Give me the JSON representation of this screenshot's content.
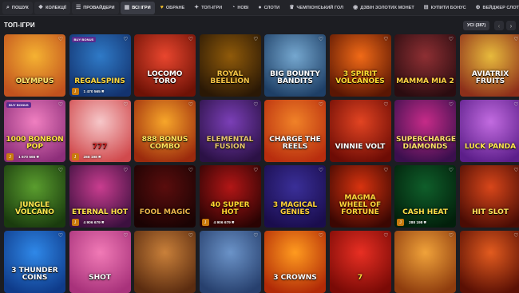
{
  "nav": [
    {
      "label": "ПОШУК",
      "icon": "search-icon",
      "glyph": "⌕",
      "style": "normal"
    },
    {
      "label": "КОЛЕКЦІЇ",
      "icon": "collections-icon",
      "glyph": "❖",
      "style": "normal"
    },
    {
      "label": "ПРОВАЙДЕРИ",
      "icon": "providers-icon",
      "glyph": "☰",
      "style": "normal"
    },
    {
      "label": "ВСІ ІГРИ",
      "icon": "grid-icon",
      "glyph": "▦",
      "style": "active"
    },
    {
      "label": "ОБРАНЕ",
      "icon": "heart-icon",
      "glyph": "♥",
      "style": "plain"
    },
    {
      "label": "ТОП-ІГРИ",
      "icon": "fire-icon",
      "glyph": "✦",
      "style": "plain"
    },
    {
      "label": "НОВІ",
      "icon": "new-icon",
      "glyph": "◔",
      "style": "plain"
    },
    {
      "label": "СЛОТИ",
      "icon": "slots-icon",
      "glyph": "●",
      "style": "plain"
    },
    {
      "label": "ЧЕМПІОНСЬКИЙ ГОЛ",
      "icon": "trophy-icon",
      "glyph": "♛",
      "style": "plain"
    },
    {
      "label": "ДЗВІН ЗОЛОТИХ МОНЕТ",
      "icon": "coin-icon",
      "glyph": "◉",
      "style": "plain"
    },
    {
      "label": "КУПИТИ БОНУС",
      "icon": "bonus-icon",
      "glyph": "⊞",
      "style": "plain"
    },
    {
      "label": "ВЕЙДЖЕР СЛОТИ",
      "icon": "wager-icon",
      "glyph": "⊕",
      "style": "plain"
    }
  ],
  "section": {
    "title": "ТОП-ІГРИ",
    "all_label": "УСІ (387)",
    "prev": "‹",
    "next": "›"
  },
  "heart_glyph": "♡",
  "jp_glyph": "J",
  "tiles": [
    {
      "title": "OLYMPUS",
      "badge": "",
      "jackpot": "",
      "bg": [
        "#f5b232",
        "#c1521e"
      ],
      "title_color": "#ffe66d"
    },
    {
      "title": "REGALSPINS",
      "badge": "BUY BONUS",
      "jackpot": "1 470 565 ₴",
      "bg": [
        "#2f7ac7",
        "#13336f"
      ],
      "title_color": "#ffd83d"
    },
    {
      "title": "LOCOMO TORO",
      "badge": "",
      "jackpot": "",
      "bg": [
        "#e9462e",
        "#6e1206"
      ],
      "title_color": "#ffffff"
    },
    {
      "title": "ROYAL BEELLION",
      "badge": "",
      "jackpot": "",
      "bg": [
        "#8f5a0a",
        "#2a1805"
      ],
      "title_color": "#f6c545"
    },
    {
      "title": "BIG BOUNTY BANDITS",
      "badge": "",
      "jackpot": "",
      "bg": [
        "#75a7cf",
        "#1e3f66"
      ],
      "title_color": "#ffffff"
    },
    {
      "title": "3 SPIRIT VOLCANOES",
      "badge": "",
      "jackpot": "",
      "bg": [
        "#f16a17",
        "#5a1603"
      ],
      "title_color": "#ffdd33"
    },
    {
      "title": "MAMMA MIA 2",
      "badge": "",
      "jackpot": "",
      "bg": [
        "#8e2f33",
        "#2a0c10"
      ],
      "title_color": "#ffd544"
    },
    {
      "title": "AVIATRIX FRUITS",
      "badge": "",
      "jackpot": "",
      "bg": [
        "#e7ba3c",
        "#8d2f1a"
      ],
      "title_color": "#ffffff"
    },
    {
      "title": "1000 BONBON POP",
      "badge": "BUY BONUS",
      "jackpot": "1 670 565 ₴",
      "bg": [
        "#f07fc0",
        "#8d2e7a"
      ],
      "title_color": "#ffe33e"
    },
    {
      "title": "777",
      "badge": "",
      "jackpot": "288 198 ₴",
      "bg": [
        "#f6c7c9",
        "#d14a4d"
      ],
      "title_color": "#d21d1d"
    },
    {
      "title": "888 BONUS COMBO",
      "badge": "",
      "jackpot": "",
      "bg": [
        "#f7a62a",
        "#9b2a0d"
      ],
      "title_color": "#ffe35b"
    },
    {
      "title": "ELEMENTAL FUSION",
      "badge": "",
      "jackpot": "",
      "bg": [
        "#7b3fb7",
        "#2b1145"
      ],
      "title_color": "#e7c66a"
    },
    {
      "title": "CHARGE THE REELS",
      "badge": "",
      "jackpot": "",
      "bg": [
        "#f08228",
        "#b82d0e"
      ],
      "title_color": "#ffffff"
    },
    {
      "title": "VINNIE VOLT",
      "badge": "",
      "jackpot": "",
      "bg": [
        "#e24422",
        "#6d0c05"
      ],
      "title_color": "#ffffff"
    },
    {
      "title": "SUPERCHARGED DIAMONDS",
      "badge": "",
      "jackpot": "",
      "bg": [
        "#c62b88",
        "#3b0f4e"
      ],
      "title_color": "#ffe06a"
    },
    {
      "title": "LUCK PANDA",
      "badge": "",
      "jackpot": "",
      "bg": [
        "#c26be0",
        "#5c1e8a"
      ],
      "title_color": "#ffe650"
    },
    {
      "title": "JUNGLE VOLCANO",
      "badge": "",
      "jackpot": "",
      "bg": [
        "#5a9d2e",
        "#1a3b0e"
      ],
      "title_color": "#ffe64d"
    },
    {
      "title": "ETERNAL HOT",
      "badge": "",
      "jackpot": "4 906 679 ₴",
      "bg": [
        "#c93d8f",
        "#3c103f"
      ],
      "title_color": "#ffe24a"
    },
    {
      "title": "FOOL MAGIC",
      "badge": "",
      "jackpot": "",
      "bg": [
        "#5a0d0d",
        "#1a0303"
      ],
      "title_color": "#e8b54a"
    },
    {
      "title": "40 SUPER HOT",
      "badge": "",
      "jackpot": "4 906 679 ₴",
      "bg": [
        "#b21616",
        "#2a0303"
      ],
      "title_color": "#ffd630"
    },
    {
      "title": "3 MAGICAL GENIES",
      "badge": "",
      "jackpot": "",
      "bg": [
        "#3a2f98",
        "#1a0d4d"
      ],
      "title_color": "#ffd23a"
    },
    {
      "title": "MAGMA WHEEL OF FORTUNE",
      "badge": "",
      "jackpot": "",
      "bg": [
        "#d8330f",
        "#3b0702"
      ],
      "title_color": "#ffd53a"
    },
    {
      "title": "CASH HEAT",
      "badge": "",
      "jackpot": "288 198 ₴",
      "bg": [
        "#0f5e2a",
        "#021f0b"
      ],
      "title_color": "#ffe04a"
    },
    {
      "title": "HIT SLOT",
      "badge": "",
      "jackpot": "",
      "bg": [
        "#d8461a",
        "#4a0c04"
      ],
      "title_color": "#ffe35a"
    },
    {
      "title": "3 THUNDER COINS",
      "badge": "",
      "jackpot": "",
      "bg": [
        "#2f88e8",
        "#0f3b8a"
      ],
      "title_color": "#ffffff"
    },
    {
      "title": "SHOT",
      "badge": "",
      "jackpot": "",
      "bg": [
        "#f17ab6",
        "#a8327b"
      ],
      "title_color": "#ffffff"
    },
    {
      "title": "",
      "badge": "",
      "jackpot": "",
      "bg": [
        "#c9803a",
        "#5b2c10"
      ],
      "title_color": "#ffffff"
    },
    {
      "title": "",
      "badge": "",
      "jackpot": "",
      "bg": [
        "#6b93c8",
        "#27406e"
      ],
      "title_color": "#ffffff"
    },
    {
      "title": "3 CROWNS",
      "badge": "",
      "jackpot": "",
      "bg": [
        "#ff9b1f",
        "#b12a07"
      ],
      "title_color": "#ffffff"
    },
    {
      "title": "7",
      "badge": "",
      "jackpot": "",
      "bg": [
        "#e82f23",
        "#7a0a06"
      ],
      "title_color": "#ffd83a"
    },
    {
      "title": "",
      "badge": "",
      "jackpot": "",
      "bg": [
        "#f0a23a",
        "#8e3c0e"
      ],
      "title_color": "#ffffff"
    },
    {
      "title": "",
      "badge": "",
      "jackpot": "",
      "bg": [
        "#e25b1f",
        "#5b1004"
      ],
      "title_color": "#ffffff"
    }
  ]
}
